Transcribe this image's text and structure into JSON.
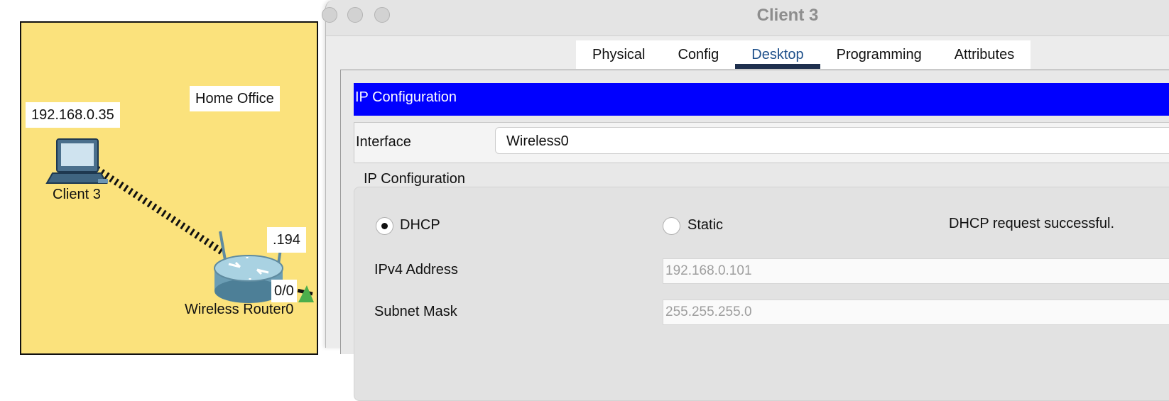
{
  "topology": {
    "area_label": "Home Office",
    "client": {
      "ip_note": "192.168.0.35",
      "label": "Client 3"
    },
    "router": {
      "label": "Wireless Router0",
      "ip_suffix_note": ".194",
      "port_label": "0/0"
    },
    "colors": {
      "area_fill": "#fbe27c",
      "link_arrow": "#4cae4c"
    }
  },
  "window": {
    "title": "Client 3",
    "tabs": [
      {
        "label": "Physical"
      },
      {
        "label": "Config"
      },
      {
        "label": "Desktop",
        "active": true
      },
      {
        "label": "Programming"
      },
      {
        "label": "Attributes"
      }
    ],
    "ip_config": {
      "header": "IP Configuration",
      "interface_label": "Interface",
      "interface_value": "Wireless0",
      "group_title": "IP Configuration",
      "dhcp_label": "DHCP",
      "static_label": "Static",
      "mode": "DHCP",
      "status_message": "DHCP request successful.",
      "ipv4_label": "IPv4 Address",
      "ipv4_value": "192.168.0.101",
      "subnet_label": "Subnet Mask",
      "subnet_value": "255.255.255.0"
    },
    "colors": {
      "header_bg": "#0000ff",
      "active_tab_underline": "#1e2f4d"
    }
  }
}
